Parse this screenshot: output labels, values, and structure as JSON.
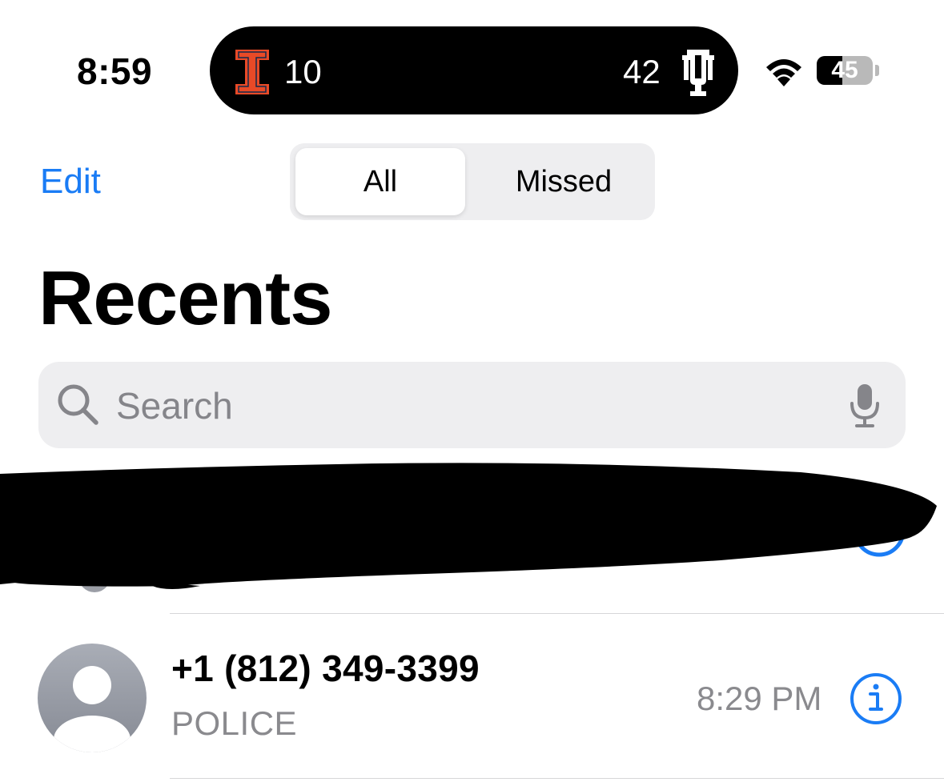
{
  "status_bar": {
    "time": "8:59",
    "battery_level": 45,
    "battery_label": "45"
  },
  "live_activity": {
    "home_team_icon": "illinois-block-i-logo",
    "home_score": "10",
    "away_score": "42",
    "away_team_icon": "indiana-iu-logo",
    "home_color": "#e84a27"
  },
  "nav": {
    "edit_label": "Edit",
    "segments": [
      {
        "label": "All",
        "selected": true
      },
      {
        "label": "Missed",
        "selected": false
      }
    ]
  },
  "page": {
    "title": "Recents"
  },
  "search": {
    "placeholder": "Search"
  },
  "recents": [
    {
      "number": "+1 (812) 349-3399",
      "label": "POLICE",
      "time": "8:29 PM",
      "avatar_icon": "person-placeholder-icon"
    }
  ],
  "colors": {
    "accent": "#1a7cf5",
    "secondary_text": "#8a8a8e",
    "fill": "#eeeef0"
  }
}
